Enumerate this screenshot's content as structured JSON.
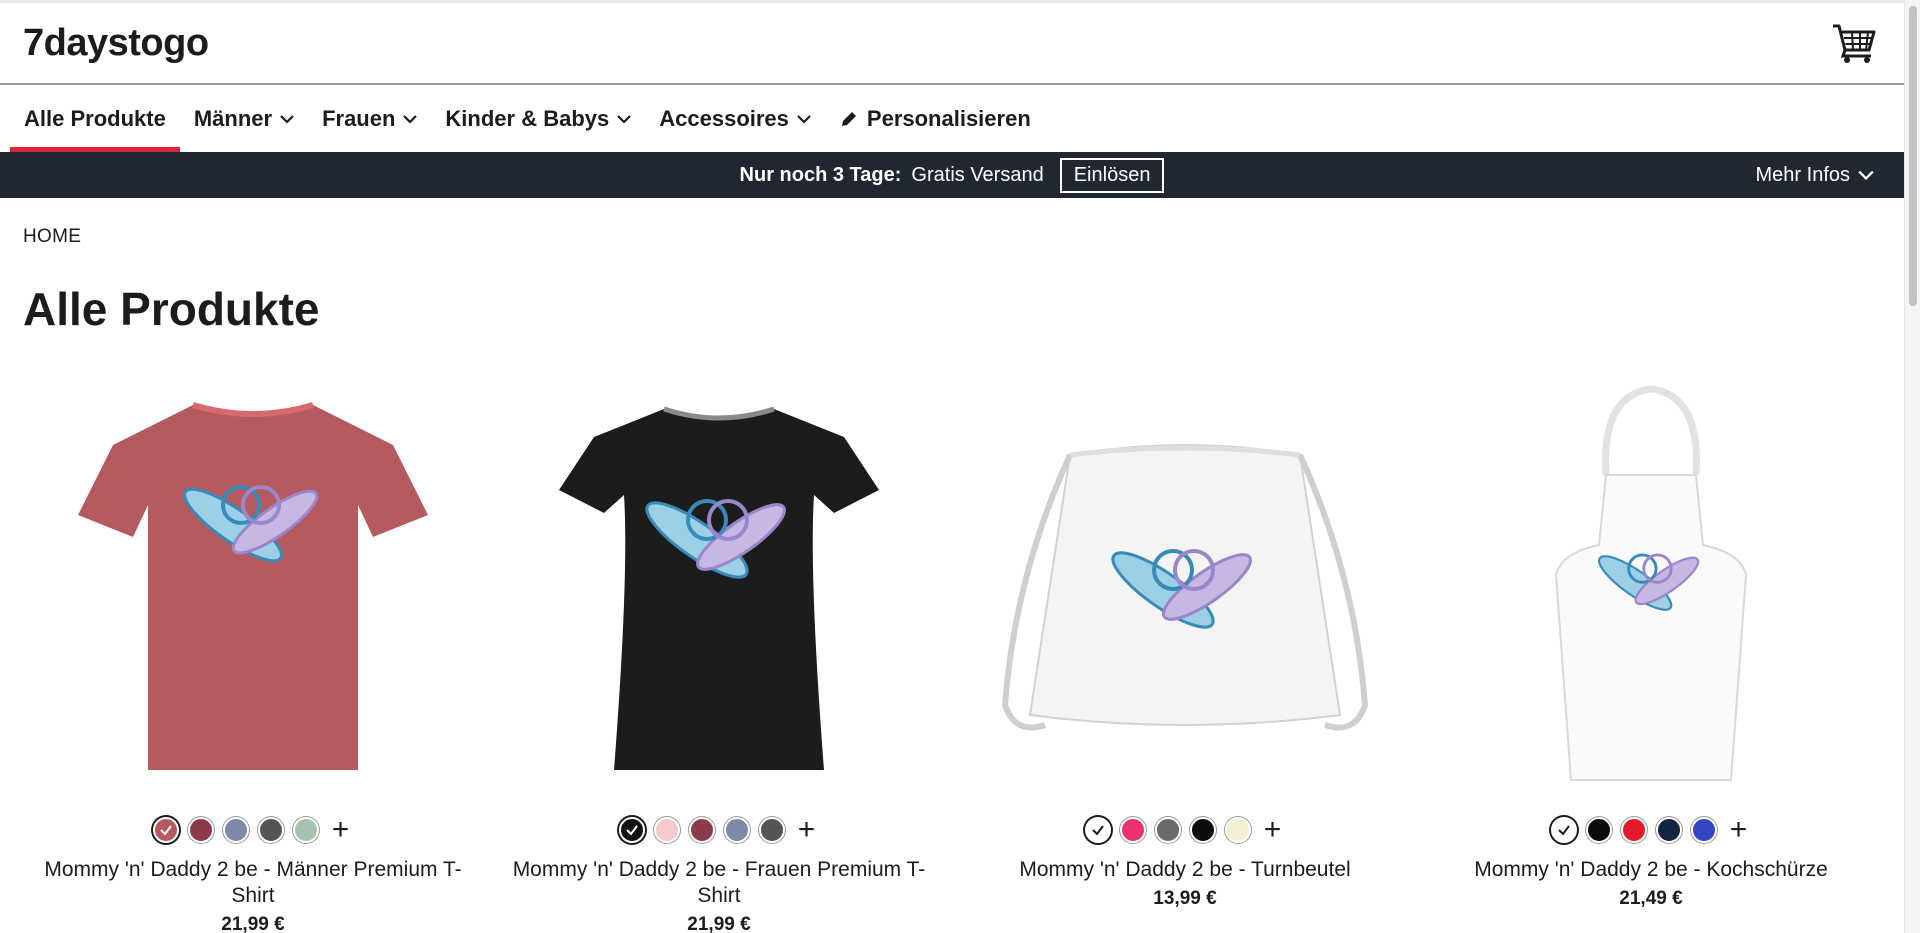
{
  "site": {
    "logo": "7daystogo"
  },
  "nav": {
    "items": [
      {
        "label": "Alle Produkte"
      },
      {
        "label": "Männer"
      },
      {
        "label": "Frauen"
      },
      {
        "label": "Kinder & Babys"
      },
      {
        "label": "Accessoires"
      },
      {
        "label": "Personalisieren"
      }
    ],
    "active_index": 0
  },
  "promo": {
    "bold": "Nur noch 3 Tage:",
    "text": "Gratis Versand",
    "button": "Einlösen",
    "more": "Mehr Infos"
  },
  "breadcrumb": "HOME",
  "page_title": "Alle Produkte",
  "products": [
    {
      "name": "Mommy 'n' Daddy 2 be - Männer Premium T-Shirt",
      "price": "21,99 €",
      "product_color": "#b55a5e",
      "swatches": [
        "#b55a62",
        "#8e3a4a",
        "#7d8aa8",
        "#555555",
        "#a8c0ae"
      ]
    },
    {
      "name": "Mommy 'n' Daddy 2 be - Frauen Premium T-Shirt",
      "price": "21,99 €",
      "product_color": "#1c1c1c",
      "swatches": [
        "#111111",
        "#f6c9cd",
        "#8e3a4a",
        "#7d8aa8",
        "#555555"
      ]
    },
    {
      "name": "Mommy 'n' Daddy 2 be - Turnbeutel",
      "price": "13,99 €",
      "product_color": "#f6f6f6",
      "swatches": [
        "#ffffff",
        "#e8336f",
        "#6a6a6a",
        "#0c0c0c",
        "#f5efd2"
      ]
    },
    {
      "name": "Mommy 'n' Daddy 2 be - Kochschürze",
      "price": "21,49 €",
      "product_color": "#fafafa",
      "swatches": [
        "#ffffff",
        "#0c0c0c",
        "#e31a2a",
        "#142445",
        "#3246c4"
      ]
    }
  ],
  "colors": {
    "accent": "#d6263a",
    "promo_bg": "#202731"
  }
}
